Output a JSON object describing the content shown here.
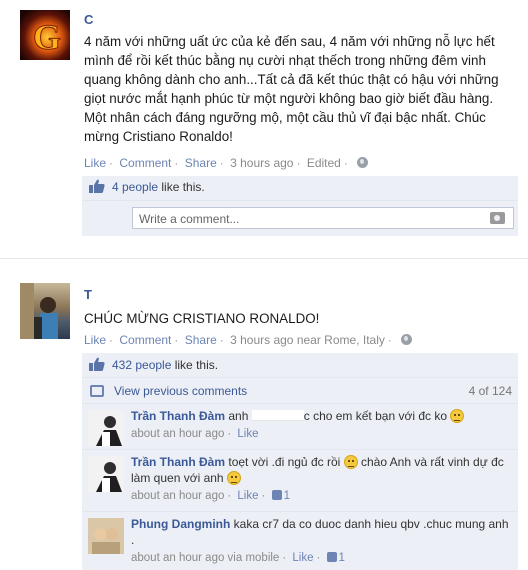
{
  "post1": {
    "author": "C",
    "text": "4 năm với những uất ức của kẻ đến sau, 4 năm với những nỗ lực hết mình để rồi kết thúc bằng nụ cười nhạt thếch trong những đêm vinh quang không dành cho anh...Tất cả đã kết thúc thật có hậu với những giọt nước mắt hạnh phúc từ một người không bao giờ biết đầu hàng. Một nhân cách đáng ngưỡng mộ, một cầu thủ vĩ đại bậc nhất. Chúc mừng Cristiano Ronaldo!",
    "actions": {
      "like": "Like",
      "comment": "Comment",
      "share": "Share",
      "time": "3 hours ago",
      "edited": "Edited"
    },
    "likes": {
      "count_text": "4 people",
      "suffix": " like this."
    },
    "comment_placeholder": "Write a comment..."
  },
  "post2": {
    "author": "T",
    "text": "CHÚC MỪNG CRISTIANO RONALDO!",
    "actions": {
      "like": "Like",
      "comment": "Comment",
      "share": "Share",
      "time": "3 hours ago",
      "location": "near Rome, Italy"
    },
    "likes": {
      "count_text": "432 people",
      "suffix": " like this."
    },
    "view_previous": "View previous comments",
    "comment_count": "4 of 124",
    "comments": [
      {
        "name": "Trần Thanh Đàm",
        "text_a": "anh",
        "text_b": "c cho em kết bạn với đc ko",
        "time": "about an hour ago",
        "like": "Like"
      },
      {
        "name": "Trần Thanh Đàm",
        "text_a": "toẹt vời .đi ngủ đc rồi",
        "text_b": "chào Anh và rất vinh dự đc làm quen với anh",
        "time": "about an hour ago",
        "like": "Like",
        "likes": "1"
      },
      {
        "name": "Phung Dangminh",
        "text_a": "kaka cr7 da co duoc danh hieu qbv .chuc mung anh .",
        "time": "about an hour ago via mobile",
        "like": "Like",
        "likes": "1"
      }
    ]
  },
  "colors": {
    "link": "#3b5998",
    "meta": "#8a8a8a",
    "ufi_bg": "#eceff5"
  }
}
